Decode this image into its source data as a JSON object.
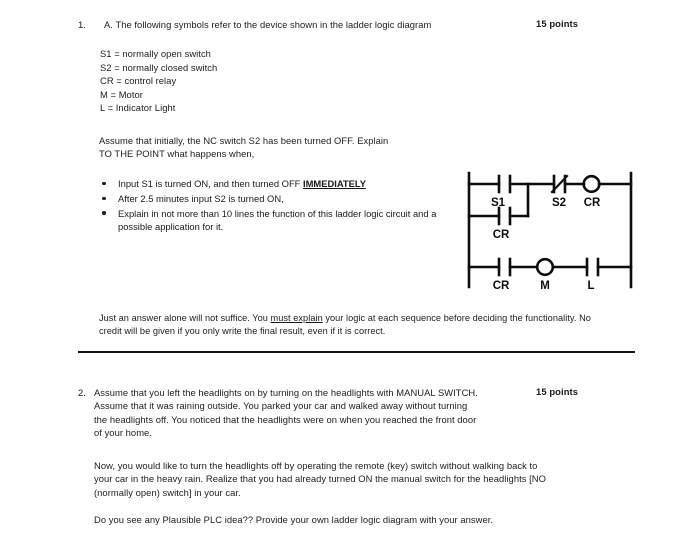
{
  "document": {
    "type": "exam-worksheet",
    "ink_color": "#1d1d1d"
  },
  "question1": {
    "number": "1.",
    "prompt": "A. The following symbols refer to the device shown in the ladder logic diagram",
    "points": "15 points",
    "legend": [
      "S1 = normally open switch",
      "S2 = normally closed switch",
      "CR = control relay",
      "M = Motor",
      "L = Indicator Light"
    ],
    "assume_line1": "Assume that initially, the NC switch S2 has been turned OFF.  Explain",
    "assume_line2": "TO THE POINT what happens when,",
    "bullets": [
      {
        "text_before": "Input S1  is turned ON, and then turned OFF ",
        "emphasis": "IMMEDIATELY",
        "text_after": ""
      },
      {
        "text_before": "After 2.5 minutes input S2 is turned ON,",
        "emphasis": "",
        "text_after": ""
      },
      {
        "text_before": "Explain in not more than 10 lines the function of this ladder logic circuit and a possible application for it.",
        "emphasis": "",
        "text_after": ""
      }
    ],
    "note_part1": "Just an answer alone will not suffice.  You ",
    "note_emphasis": "must explain",
    "note_part2": " your logic at each sequence before deciding the functionality.  No credit will be given if you only write the final result, even if it is correct."
  },
  "ladder_diagram": {
    "name": "ladder-logic-diagram",
    "rungs": [
      {
        "name": "rung-1",
        "elements": [
          {
            "symbol": "contact-no",
            "label": "S1"
          },
          {
            "symbol": "contact-nc",
            "label": "S2"
          },
          {
            "symbol": "coil",
            "label": "CR"
          }
        ],
        "branch": [
          {
            "symbol": "contact-no",
            "label": "CR"
          }
        ]
      },
      {
        "name": "rung-2",
        "elements": [
          {
            "symbol": "contact-no",
            "label": "CR"
          },
          {
            "symbol": "coil",
            "label": "M"
          },
          {
            "symbol": "contact-no",
            "label": "L"
          }
        ]
      }
    ],
    "labels": {
      "r1_s1": "S1",
      "r1_s2": "S2",
      "r1_cr_coil": "CR",
      "r1_branch_cr": "CR",
      "r2_cr": "CR",
      "r2_m": "M",
      "r2_l": "L"
    }
  },
  "question2": {
    "number": "2.",
    "points": "15 points",
    "para1_lines": [
      "Assume that you left the headlights on by turning on the headlights with MANUAL SWITCH.",
      "Assume that it was raining outside.   You parked your car and walked away without turning",
      "the headlights off.  You noticed that the headlights were on when you reached the front door",
      "of your home."
    ],
    "para2_lines": [
      "Now, you would like to turn the headlights off by operating the remote (key) switch without walking back to",
      "your car in the heavy rain. Realize that you had already turned ON the manual switch for the headlights [NO",
      "(normally open) switch]  in your car."
    ],
    "para3_lines": [
      "Do you see any Plausible PLC idea??  Provide your own ladder logic diagram with your answer."
    ]
  }
}
